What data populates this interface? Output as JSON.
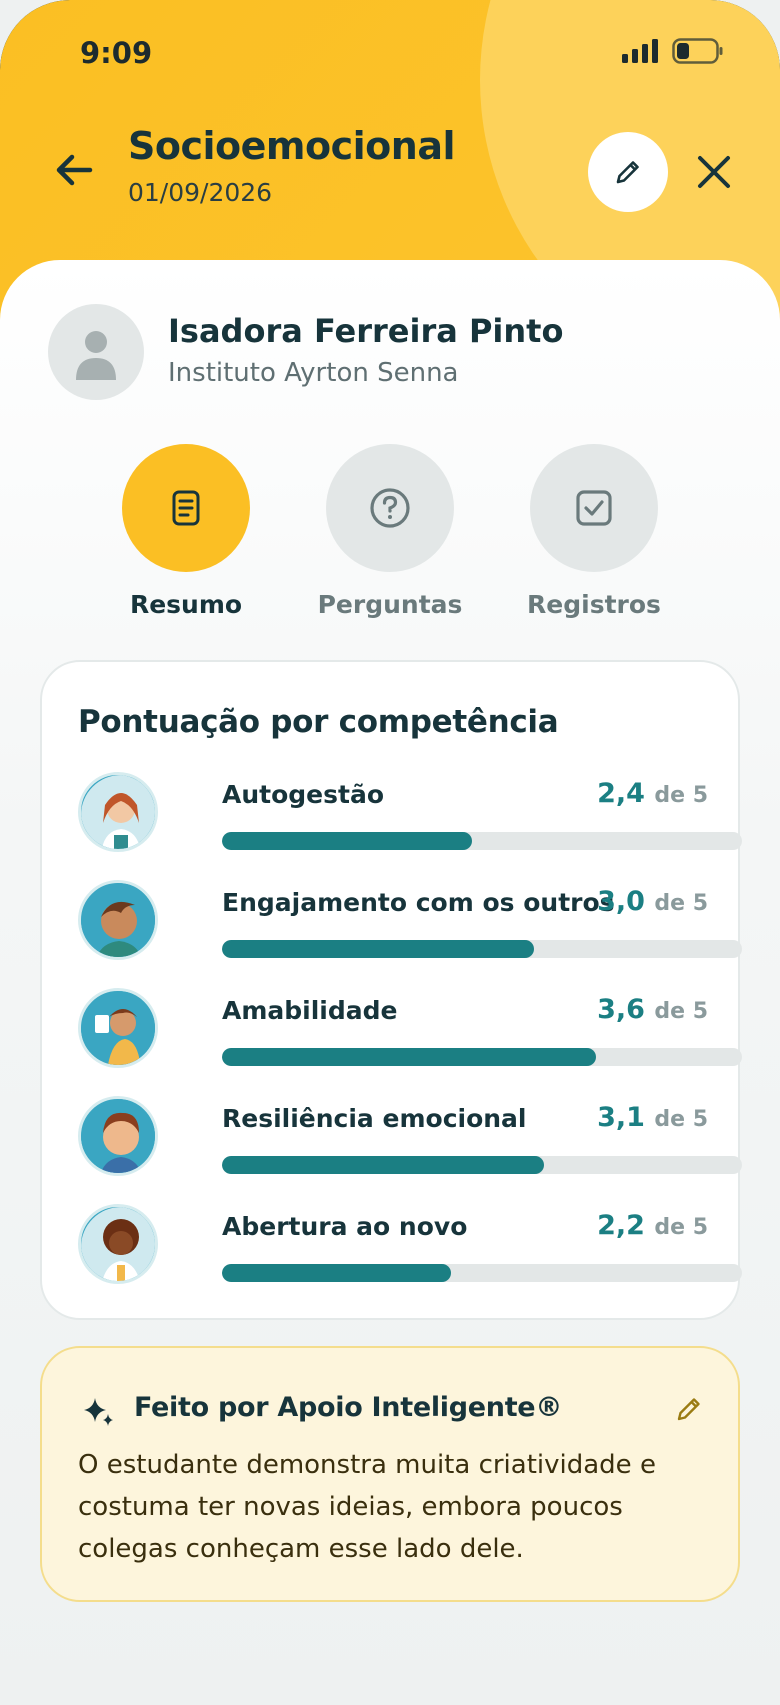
{
  "status_bar": {
    "time": "9:09"
  },
  "header": {
    "title": "Socioemocional",
    "date": "01/09/2026"
  },
  "student": {
    "name": "Isadora Ferreira Pinto",
    "school": "Instituto Ayrton Senna"
  },
  "tabs": [
    {
      "label": "Resumo",
      "icon": "document-icon",
      "active": true
    },
    {
      "label": "Perguntas",
      "icon": "question-icon",
      "active": false
    },
    {
      "label": "Registros",
      "icon": "checkbox-icon",
      "active": false
    }
  ],
  "scores": {
    "title": "Pontuação por competência",
    "of_label": "de 5",
    "items": [
      {
        "name": "Autogestão",
        "score": "2,4",
        "value": 2.4
      },
      {
        "name": "Engajamento com os outros",
        "score": "3,0",
        "value": 3.0
      },
      {
        "name": "Amabilidade",
        "score": "3,6",
        "value": 3.6
      },
      {
        "name": "Resiliência emocional",
        "score": "3,1",
        "value": 3.1
      },
      {
        "name": "Abertura ao novo",
        "score": "2,2",
        "value": 2.2
      }
    ],
    "max": 5
  },
  "ai": {
    "title": "Feito por Apoio Inteligente®",
    "text": "O estudante demonstra muita criatividade e costuma ter novas ideias, embora poucos colegas conheçam esse lado dele."
  },
  "colors": {
    "accent": "#fbbf24",
    "bar": "#1b7f83",
    "dark_text": "#17343b"
  }
}
